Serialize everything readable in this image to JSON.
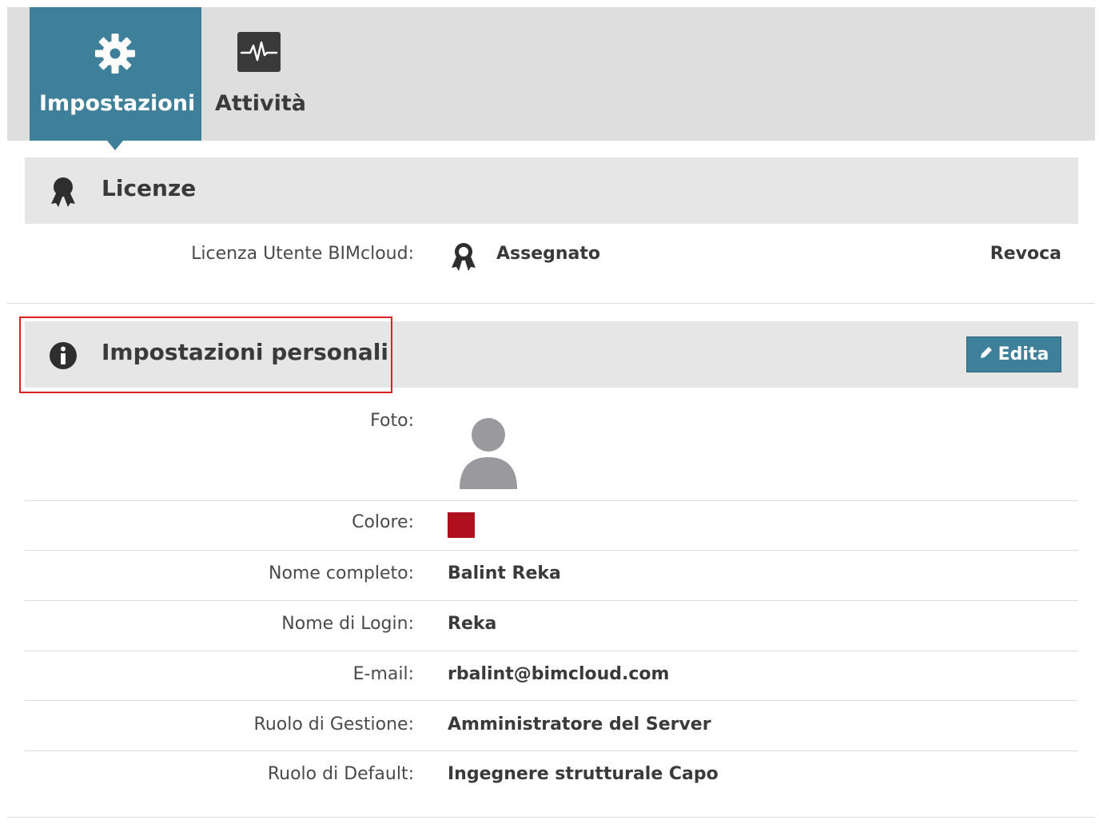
{
  "tabs": [
    {
      "label": "Impostazioni",
      "icon": "gear-icon",
      "active": true
    },
    {
      "label": "Attività",
      "icon": "activity-icon",
      "active": false
    }
  ],
  "licenses": {
    "title": "Licenze",
    "icon": "ribbon-icon",
    "row": {
      "label": "Licenza Utente BIMcloud:",
      "value": "Assegnato",
      "action": "Revoca"
    }
  },
  "personal": {
    "title": "Impostazioni personali",
    "icon": "info-icon",
    "edit_label": "Edita",
    "photo_label": "Foto:",
    "color_label": "Colore:",
    "color_value": "#b0101e",
    "fields": [
      {
        "label": "Nome completo:",
        "value": "Balint Reka"
      },
      {
        "label": "Nome di Login:",
        "value": "Reka"
      },
      {
        "label": "E-mail:",
        "value": "rbalint@bimcloud.com"
      },
      {
        "label": "Ruolo di Gestione:",
        "value": "Amministratore del Server"
      },
      {
        "label": "Ruolo di Default:",
        "value": "Ingegnere strutturale Capo"
      }
    ]
  },
  "colors": {
    "accent": "#3e7f99",
    "tabbar_bg": "#dedede",
    "section_bg": "#e6e6e6",
    "highlight": "#e02020"
  }
}
